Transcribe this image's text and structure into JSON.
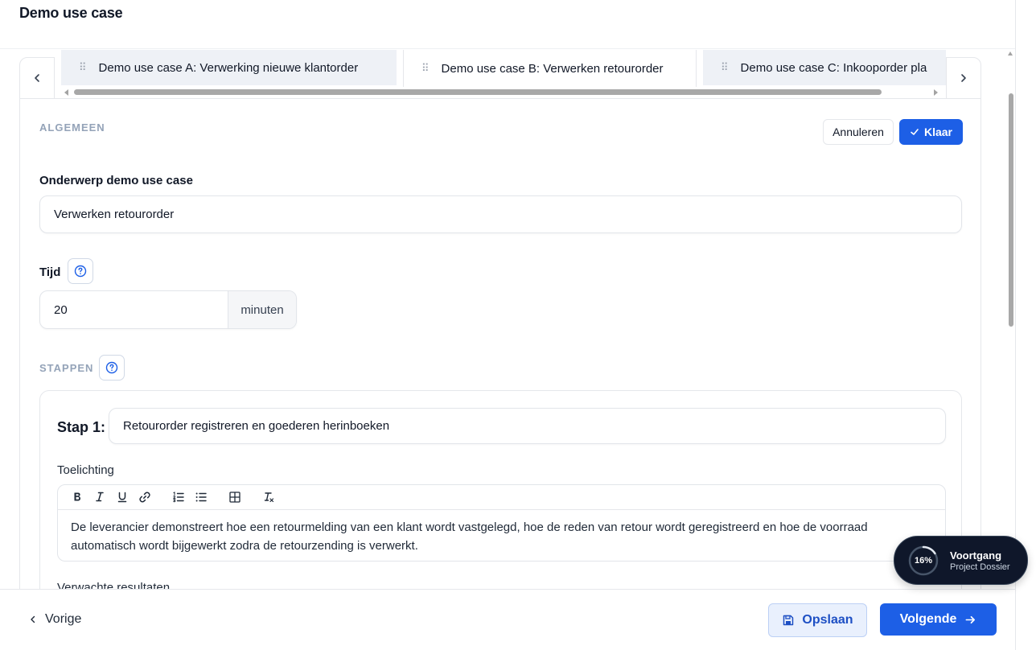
{
  "header": {
    "title": "Demo use case"
  },
  "tabs": [
    {
      "label": "Demo use case A: Verwerking nieuwe klantorder",
      "active": false
    },
    {
      "label": "Demo use case B: Verwerken retourorder",
      "active": true
    },
    {
      "label": "Demo use case C: Inkooporder pla",
      "active": false
    }
  ],
  "tab_grip_glyph": "⠿",
  "general": {
    "section_label": "ALGEMEEN",
    "cancel_label": "Annuleren",
    "done_label": "Klaar",
    "subject_label": "Onderwerp demo use case",
    "subject_value": "Verwerken retourorder",
    "time_label": "Tijd",
    "time_value": "20",
    "time_unit": "minuten"
  },
  "steps": {
    "section_label": "STAPPEN",
    "items": [
      {
        "label": "Stap 1:",
        "title_value": "Retourorder registreren en goederen herinboeken",
        "explanation_label": "Toelichting",
        "explanation_text": "De leverancier demonstreert hoe een retourmelding van een klant wordt vastgelegd, hoe de reden van retour wordt geregistreerd en hoe de voorraad automatisch wordt bijgewerkt zodra de retourzending is verwerkt.",
        "expected_results_label": "Verwachte resultaten"
      }
    ]
  },
  "editor_toolbar": [
    "bold",
    "italic",
    "underline",
    "link",
    "ordered-list",
    "bullet-list",
    "table",
    "clear-format"
  ],
  "footer": {
    "prev_label": "Vorige",
    "save_label": "Opslaan",
    "next_label": "Volgende"
  },
  "progress": {
    "percent_label": "16%",
    "percent_value": 0.16,
    "title": "Voortgang",
    "subtitle": "Project Dossier"
  },
  "colors": {
    "primary": "#1d5fe6",
    "section_label": "#94a3b8",
    "progress_bg": "#0f172a"
  }
}
